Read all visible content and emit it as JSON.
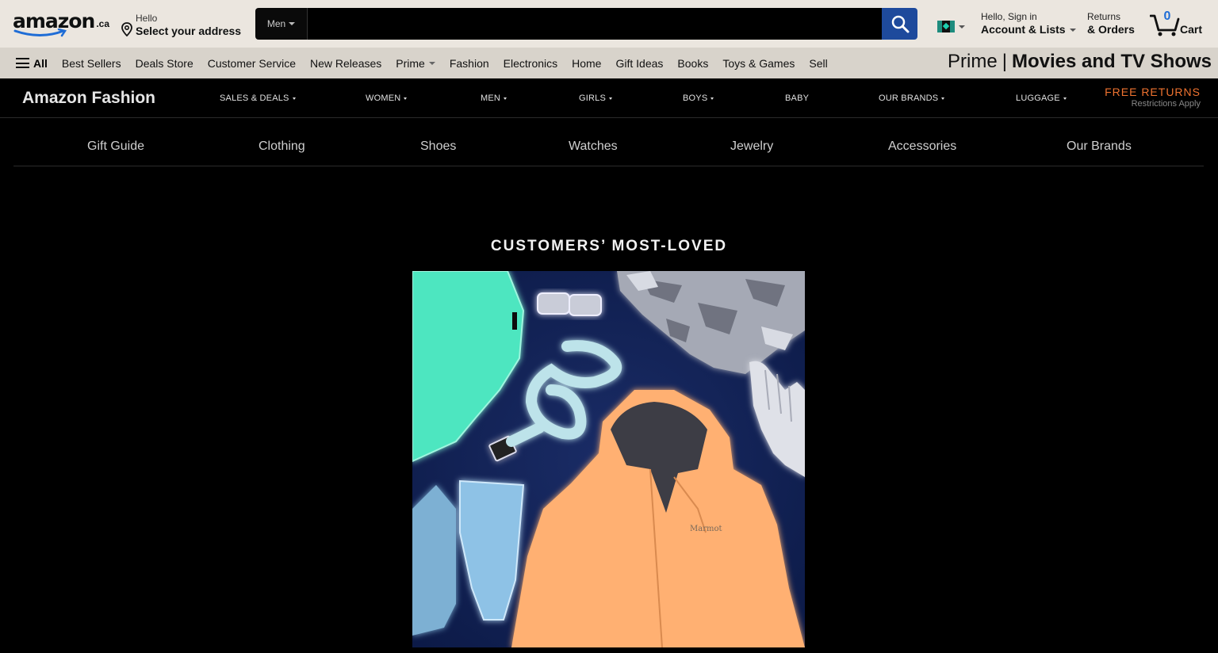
{
  "topnav": {
    "logo_text": "amazon",
    "logo_tld": ".ca",
    "address_line1": "Hello",
    "address_line2": "Select your address",
    "search_dept": "Men",
    "search_placeholder": "",
    "account_line1": "Hello, Sign in",
    "account_line2": "Account & Lists",
    "returns_line1": "Returns",
    "returns_line2": "& Orders",
    "cart_count": "0",
    "cart_label": "Cart"
  },
  "subnav": {
    "all_label": "All",
    "items": [
      "Best Sellers",
      "Deals Store",
      "Customer Service",
      "New Releases",
      "Prime",
      "Fashion",
      "Electronics",
      "Home",
      "Gift Ideas",
      "Books",
      "Toys & Games",
      "Sell"
    ],
    "banner_prime": "Prime",
    "banner_sep": "|",
    "banner_title": "Movies and TV Shows"
  },
  "fashion": {
    "title": "Amazon Fashion",
    "nav": [
      "SALES & DEALS",
      "WOMEN",
      "MEN",
      "GIRLS",
      "BOYS",
      "BABY",
      "OUR BRANDS",
      "LUGGAGE"
    ],
    "free_returns": "FREE RETURNS",
    "restrictions": "Restrictions Apply"
  },
  "categories": [
    "Gift Guide",
    "Clothing",
    "Shoes",
    "Watches",
    "Jewelry",
    "Accessories",
    "Our Brands"
  ],
  "hero": {
    "title": "CUSTOMERS’ MOST-LOVED",
    "jacket_brand": "Marmot"
  },
  "colors": {
    "search_button": "#1e4a9c",
    "free_returns": "#f07330",
    "cart_count": "#1f6dd6"
  }
}
